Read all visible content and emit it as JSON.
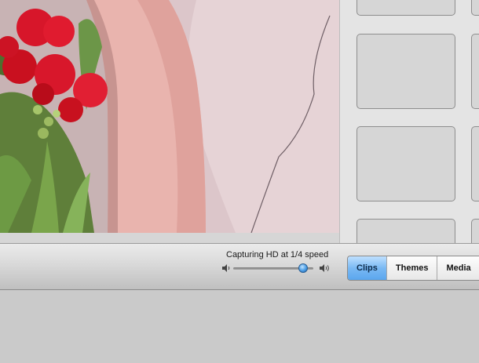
{
  "status": {
    "capture_text": "Capturing HD at 1/4 speed"
  },
  "volume": {
    "level": 0.92,
    "icons": [
      "speaker-low-icon",
      "speaker-high-icon"
    ]
  },
  "tabs": [
    {
      "label": "Clips",
      "active": true
    },
    {
      "label": "Themes",
      "active": false
    },
    {
      "label": "Media",
      "active": false
    }
  ],
  "colors": {
    "active_tab": "#6aaff0",
    "toolbar": "#d9d9d9"
  }
}
